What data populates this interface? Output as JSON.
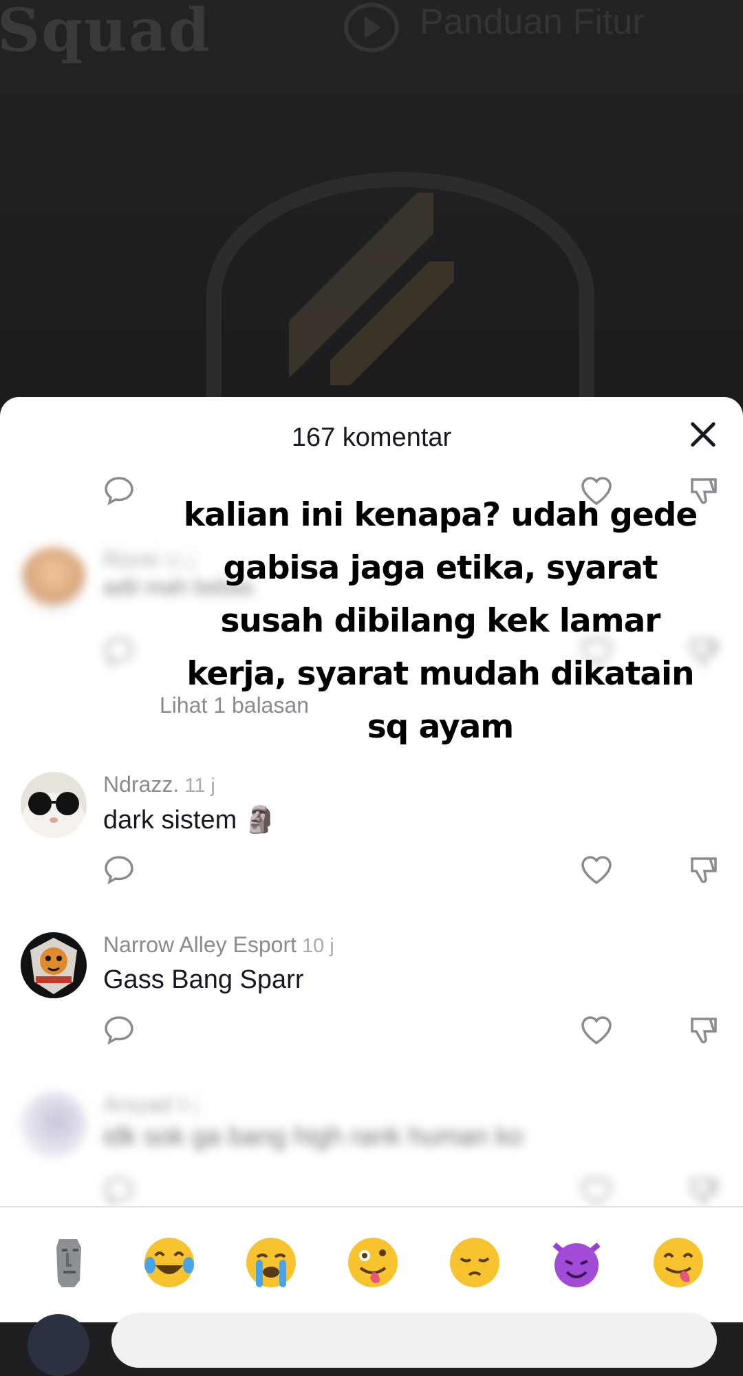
{
  "background": {
    "brand_text": "Squad",
    "guide_text": "Panduan Fitur"
  },
  "sheet": {
    "title": "167 komentar"
  },
  "comments": [
    {
      "username": "Rizmi",
      "time": "11 j",
      "text": "adit mah bebas",
      "blurred": true
    },
    {
      "username": "Ndrazz.",
      "time": "11 j",
      "text": "dark sistem 🗿",
      "blurred": false
    },
    {
      "username": "Narrow Alley Esport",
      "time": "10 j",
      "text": "Gass Bang Sparr",
      "blurred": false
    },
    {
      "username": "Arsyad",
      "time": "9 j",
      "text": "idk sok ga bang high rank human ko",
      "blurred": true
    }
  ],
  "replies_link": "Lihat 1 balasan",
  "caption": "kalian ini kenapa? udah gede gabisa jaga etika, syarat susah dibilang kek lamar kerja, syarat mudah dikatain sq ayam",
  "emoji_bar": [
    "🗿",
    "😂",
    "😭",
    "🤪",
    "😔",
    "😈",
    "😋"
  ],
  "colors": {
    "sheet_bg": "#ffffff",
    "primary_text": "#161823",
    "secondary_text": "#8a8b91"
  }
}
